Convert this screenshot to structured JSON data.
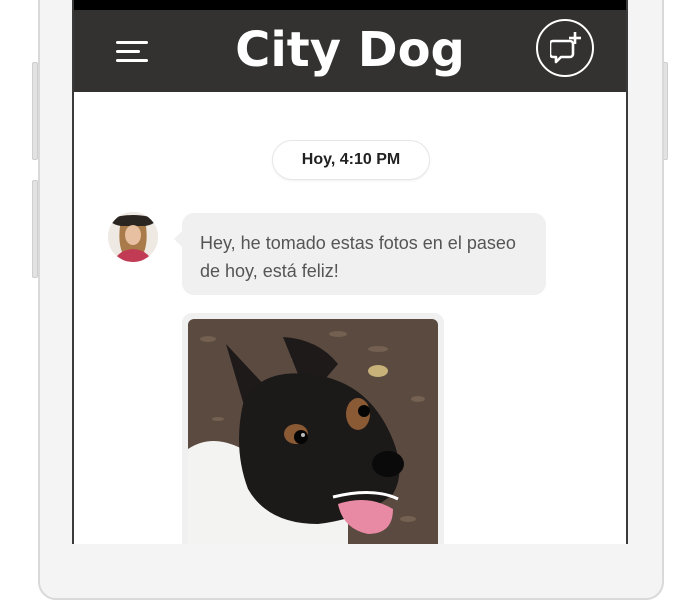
{
  "app": {
    "title": "City Dog"
  },
  "header": {
    "menu_icon": "hamburger-menu-icon",
    "action_icon": "new-chat-icon"
  },
  "chat": {
    "timestamp": "Hoy, 4:10 PM",
    "messages": [
      {
        "type": "text",
        "text": "Hey, he tomado estas fotos en el paseo de hoy, está feliz!"
      },
      {
        "type": "image",
        "subject": "dog-photo"
      }
    ]
  },
  "colors": {
    "appbar": "#333230",
    "bubble": "#f0f0f0",
    "text_on_bar": "#ffffff"
  }
}
